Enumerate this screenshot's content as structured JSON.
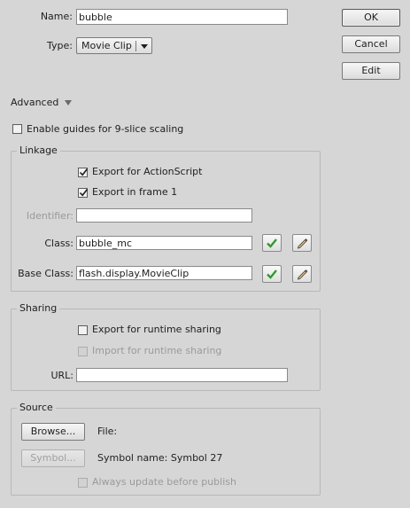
{
  "symbol": {
    "name_label": "Name:",
    "name_value": "bubble",
    "type_label": "Type:",
    "type_value": "Movie Clip"
  },
  "buttons": {
    "ok": "OK",
    "cancel": "Cancel",
    "edit": "Edit"
  },
  "advanced": {
    "label": "Advanced",
    "enable_guides": {
      "label": "Enable guides for 9-slice scaling",
      "checked": false
    }
  },
  "linkage": {
    "title": "Linkage",
    "export_actionscript": {
      "label": "Export for ActionScript",
      "checked": true
    },
    "export_frame1": {
      "label": "Export in frame 1",
      "checked": true
    },
    "identifier_label": "Identifier:",
    "identifier_value": "",
    "class_label": "Class:",
    "class_value": "bubble_mc",
    "base_class_label": "Base Class:",
    "base_class_value": "flash.display.MovieClip"
  },
  "sharing": {
    "title": "Sharing",
    "export_runtime": {
      "label": "Export for runtime sharing",
      "checked": false
    },
    "import_runtime": {
      "label": "Import for runtime sharing",
      "checked": false,
      "disabled": true
    },
    "url_label": "URL:",
    "url_value": ""
  },
  "source": {
    "title": "Source",
    "browse_label": "Browse...",
    "file_label": "File:",
    "symbol_button_label": "Symbol...",
    "symbol_name_label": "Symbol name: Symbol 27",
    "always_update": {
      "label": "Always update before publish",
      "checked": false,
      "disabled": true
    }
  },
  "colors": {
    "background": "#d6d6d6",
    "check_green": "#2f9a2f"
  }
}
